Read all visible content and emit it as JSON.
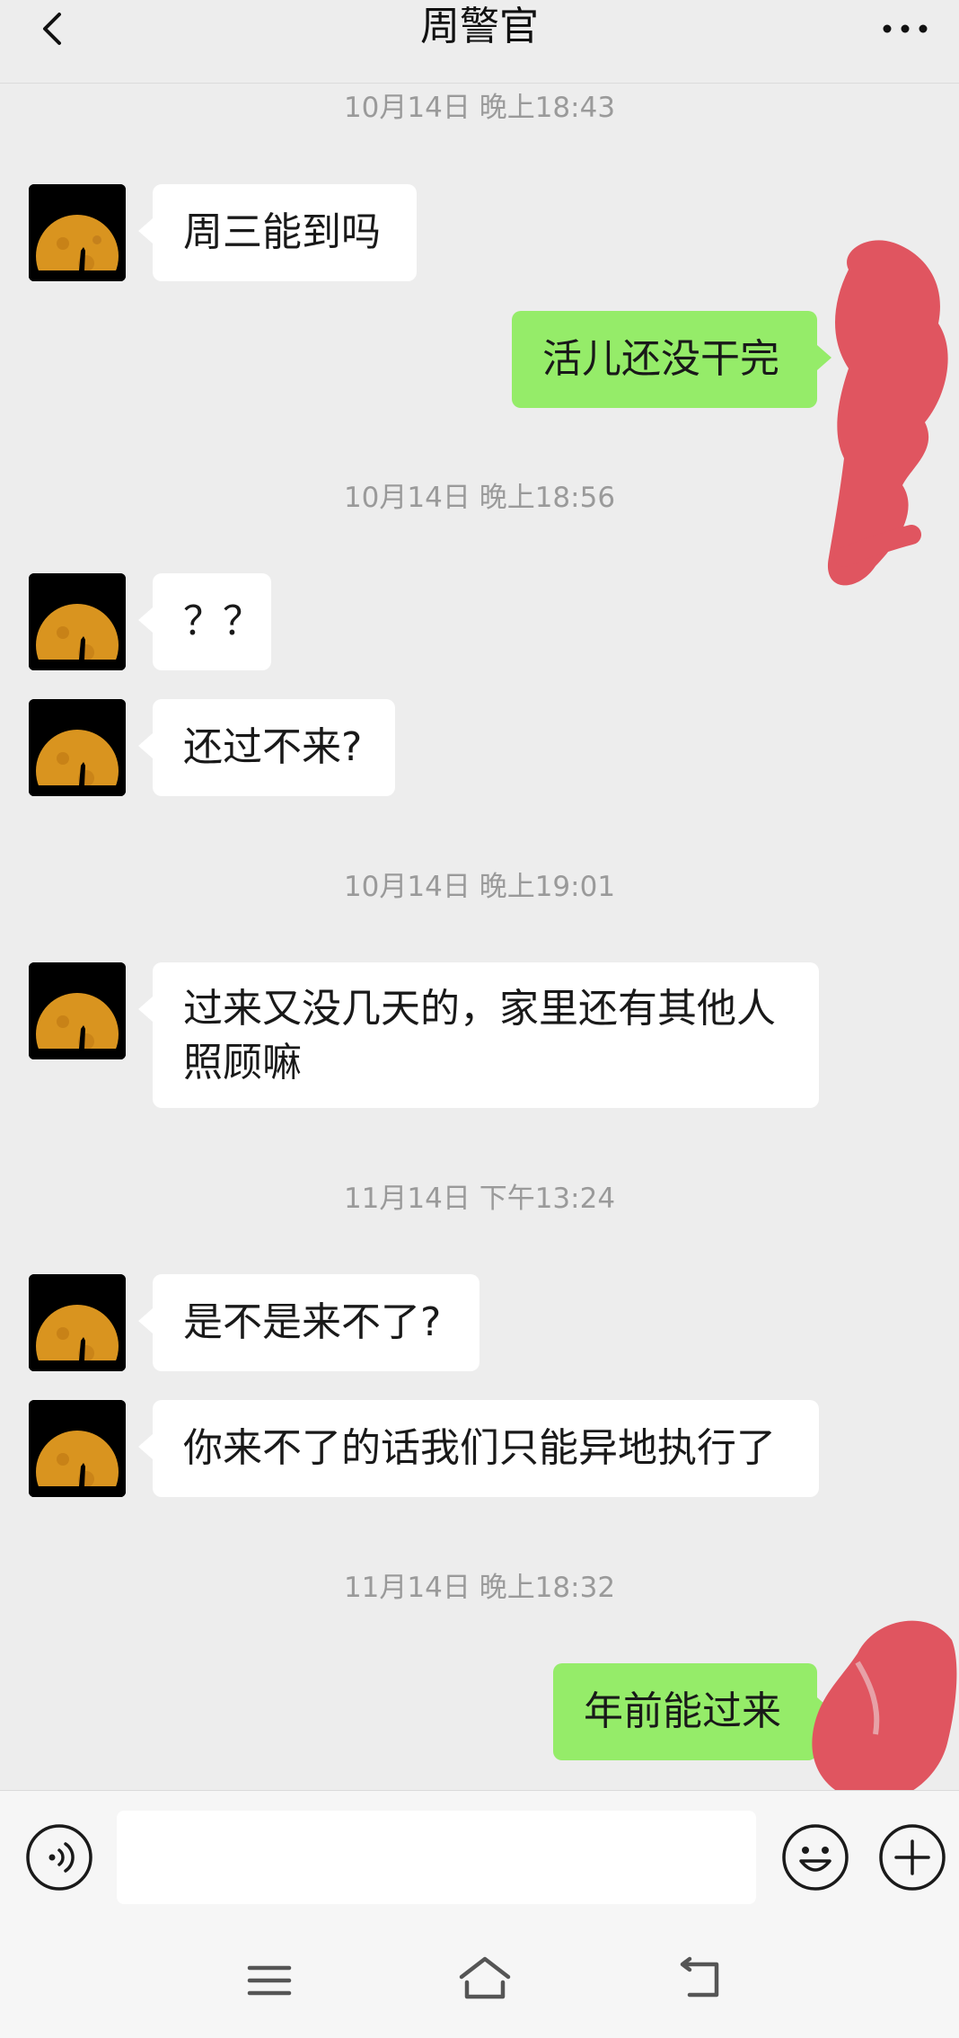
{
  "header": {
    "title": "周警官",
    "back_icon": "chevron-left-icon",
    "more_icon": "more-dots-icon"
  },
  "messages": [
    {
      "kind": "timestamp",
      "text": "10月14日 晚上18:43"
    },
    {
      "kind": "in",
      "text": "周三能到吗"
    },
    {
      "kind": "out",
      "text": "活儿还没干完"
    },
    {
      "kind": "timestamp",
      "text": "10月14日 晚上18:56"
    },
    {
      "kind": "in",
      "text": "？？"
    },
    {
      "kind": "in",
      "text": "还过不来?"
    },
    {
      "kind": "timestamp",
      "text": "10月14日 晚上19:01"
    },
    {
      "kind": "in",
      "text": "过来又没几天的，家里还有其他人照顾嘛"
    },
    {
      "kind": "timestamp",
      "text": "11月14日 下午13:24"
    },
    {
      "kind": "in",
      "text": "是不是来不了?"
    },
    {
      "kind": "in",
      "text": "你来不了的话我们只能异地执行了"
    },
    {
      "kind": "timestamp",
      "text": "11月14日 晚上18:32"
    },
    {
      "kind": "out",
      "text": "年前能过来"
    }
  ],
  "input_bar": {
    "voice_icon": "voice-icon",
    "text_value": "",
    "emoji_icon": "emoji-icon",
    "plus_icon": "plus-icon"
  },
  "navbar": {
    "menu_icon": "menu-icon",
    "home_icon": "home-icon",
    "back_icon": "back-arrow-icon"
  },
  "colors": {
    "background": "#ededed",
    "incoming_bubble": "#ffffff",
    "outgoing_bubble": "#95ec69",
    "timestamp_text": "#9a9a9a",
    "scribble": "#e05560"
  }
}
